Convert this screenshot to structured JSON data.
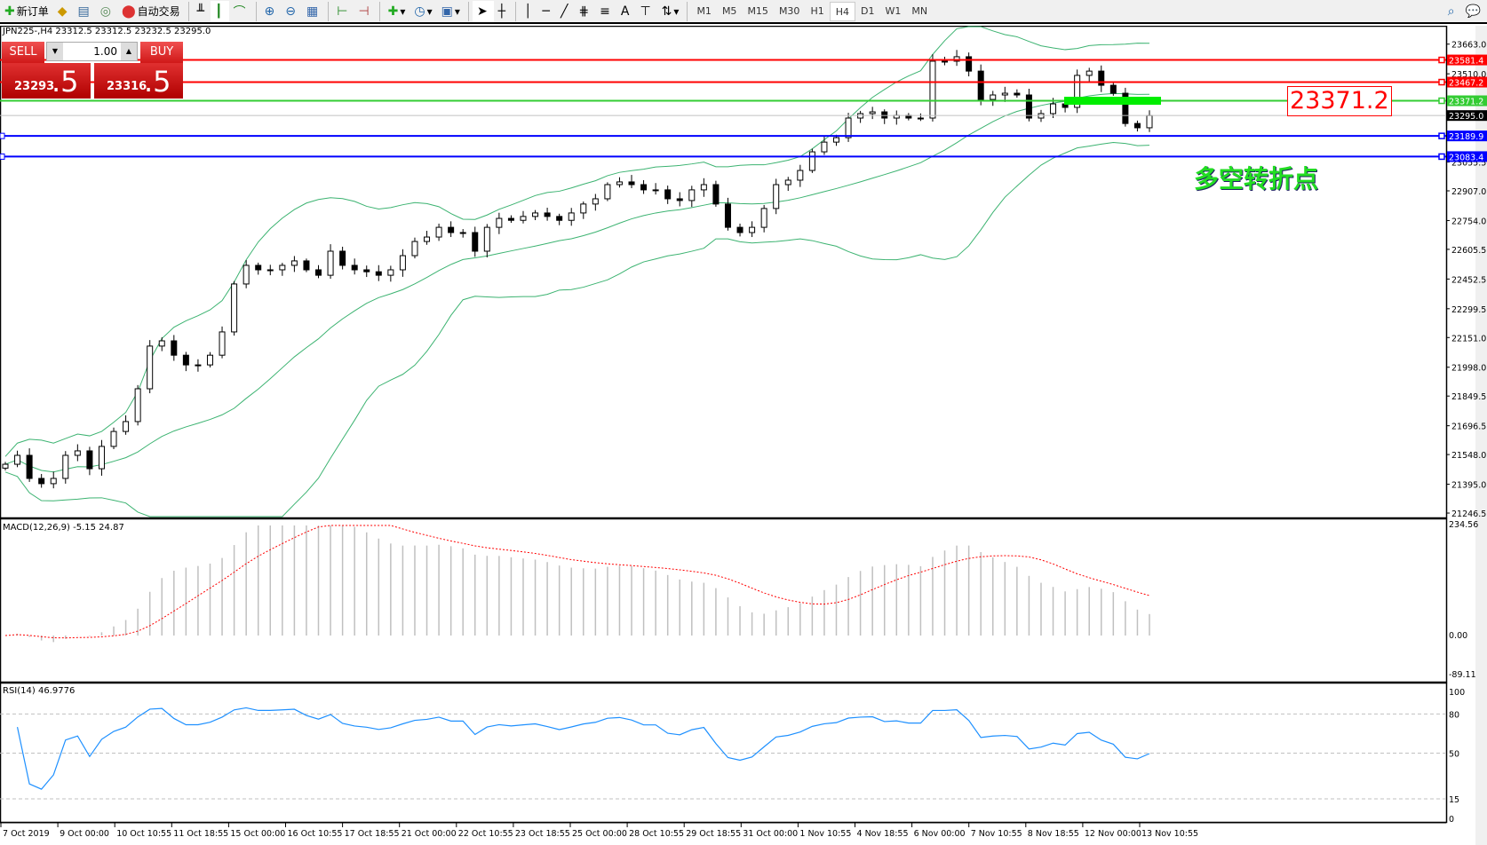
{
  "toolbar": {
    "new_order": "新订单",
    "auto_trading": "自动交易",
    "icons": [
      "new-order-icon",
      "history-icon",
      "data-window-icon",
      "signals-icon",
      "auto-trading-icon",
      "bar-chart-icon",
      "candlestick-icon",
      "line-chart-icon",
      "zoom-in-icon",
      "zoom-out-icon",
      "tile-windows-icon",
      "chart-shift-icon",
      "autoscroll-icon",
      "indicators-icon",
      "periods-icon",
      "templates-icon",
      "cursor-icon",
      "crosshair-icon",
      "vertical-line-icon",
      "horizontal-line-icon",
      "trendline-icon",
      "fibonacci-icon",
      "fibo-lines-icon",
      "text-icon",
      "text-label-icon",
      "arrows-icon",
      "search-icon",
      "chat-icon"
    ],
    "timeframes": [
      "M1",
      "M5",
      "M15",
      "M30",
      "H1",
      "H4",
      "D1",
      "W1",
      "MN"
    ],
    "active_timeframe": "H4"
  },
  "chart": {
    "header": "JPN225-,H4  23312.5 23312.5 23232.5 23295.0",
    "trade_panel": {
      "sell_label": "SELL",
      "buy_label": "BUY",
      "lot": "1.00",
      "bid_main": "23293",
      "bid_pips": ".5",
      "ask_main": "23316",
      "ask_pips": ".5"
    },
    "annotation_text": "多空转折点",
    "price_label": "23371.2",
    "colors": {
      "resistance": "#ff0000",
      "pivot": "#33cc33",
      "support": "#0000ff",
      "bollinger": "#3cb371",
      "macd_signal": "#ff0000",
      "macd_hist": "#c0c0c0",
      "rsi": "#1e90ff"
    }
  },
  "chart_data": {
    "type": "candlestick",
    "symbol": "JPN225-",
    "timeframe": "H4",
    "ylim": [
      21228,
      23753
    ],
    "price_ticks": [
      "23663.0",
      "23510.0",
      "23055.5",
      "22907.0",
      "22754.0",
      "22605.5",
      "22452.5",
      "22299.5",
      "22151.0",
      "21998.0",
      "21849.5",
      "21696.5",
      "21548.0",
      "21395.0",
      "21246.5"
    ],
    "closes": [
      21498,
      21544,
      21425,
      21398,
      21425,
      21544,
      21567,
      21475,
      21590,
      21667,
      21718,
      21887,
      22107,
      22134,
      22060,
      22010,
      22010,
      22060,
      22180,
      22427,
      22523,
      22500,
      22500,
      22523,
      22546,
      22500,
      22472,
      22596,
      22523,
      22500,
      22490,
      22472,
      22500,
      22573,
      22646,
      22669,
      22719,
      22692,
      22692,
      22596,
      22719,
      22765,
      22755,
      22775,
      22793,
      22775,
      22755,
      22793,
      22839,
      22866,
      22939,
      22953,
      22939,
      22912,
      22912,
      22866,
      22857,
      22912,
      22939,
      22839,
      22719,
      22692,
      22719,
      22816,
      22939,
      22962,
      23012,
      23108,
      23158,
      23181,
      23282,
      23305,
      23314,
      23282,
      23296,
      23282,
      23282,
      23575,
      23575,
      23598,
      23524,
      23378,
      23401,
      23410,
      23401,
      23282,
      23305,
      23355,
      23337,
      23502,
      23524,
      23451,
      23410,
      23254,
      23232,
      23295
    ],
    "horizontal_lines": [
      {
        "price": 23581.4,
        "label": "23581.4",
        "color": "#ff0000"
      },
      {
        "price": 23467.2,
        "label": "23467.2",
        "color": "#ff0000"
      },
      {
        "price": 23371.2,
        "label": "23371.2",
        "color": "#33cc33"
      },
      {
        "price": 23295.0,
        "label": "23295.0",
        "color": "#000000"
      },
      {
        "price": 23189.9,
        "label": "23189.9",
        "color": "#0000ff"
      },
      {
        "price": 23083.4,
        "label": "23083.4",
        "color": "#0000ff"
      }
    ],
    "x_labels": [
      "7 Oct 2019",
      "9 Oct 00:00",
      "10 Oct 10:55",
      "11 Oct 18:55",
      "15 Oct 00:00",
      "16 Oct 10:55",
      "17 Oct 18:55",
      "21 Oct 00:00",
      "22 Oct 10:55",
      "23 Oct 18:55",
      "25 Oct 00:00",
      "28 Oct 10:55",
      "29 Oct 18:55",
      "31 Oct 00:00",
      "1 Nov 10:55",
      "4 Nov 18:55",
      "6 Nov 00:00",
      "7 Nov 10:55",
      "8 Nov 18:55",
      "12 Nov 00:00",
      "13 Nov 10:55"
    ],
    "macd": {
      "label": "MACD(12,26,9) -5.15 24.87",
      "ylim": [
        -89.11,
        234.56
      ],
      "ticks": [
        "234.56",
        "0.00",
        "-89.11"
      ]
    },
    "rsi": {
      "label": "RSI(14) 46.9776",
      "ylim": [
        0,
        100
      ],
      "levels": [
        80,
        50,
        15
      ],
      "ticks": [
        "100",
        "80",
        "50",
        "15",
        "0"
      ]
    }
  }
}
